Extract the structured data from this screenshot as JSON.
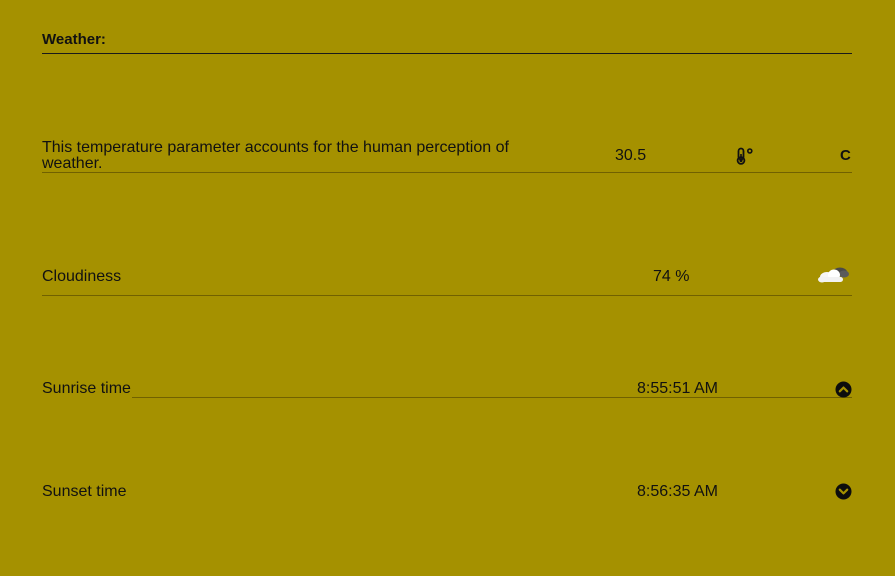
{
  "header": {
    "title": "Weather:"
  },
  "rows": [
    {
      "label": "This temperature parameter accounts for the human perception of weather.",
      "value": "30.5",
      "icon": "thermometer-icon",
      "unit": "C"
    },
    {
      "label": "Cloudiness",
      "value": "74 %",
      "icon": "cloud-icon"
    },
    {
      "label": "Sunrise time",
      "value": "8:55:51 AM",
      "icon": "chevron-up-circle-icon"
    },
    {
      "label": "Sunset time",
      "value": "8:56:35 AM",
      "icon": "chevron-down-circle-icon"
    }
  ],
  "colors": {
    "background": "#a59100",
    "text": "#111111"
  }
}
